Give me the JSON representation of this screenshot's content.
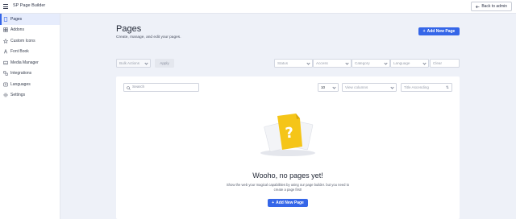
{
  "topbar": {
    "app_title": "SP Page Builder",
    "back_label": "Back to admin"
  },
  "sidebar": {
    "items": [
      {
        "label": "Pages",
        "icon": "pages-icon",
        "active": true
      },
      {
        "label": "Addons",
        "icon": "addons-icon"
      },
      {
        "label": "Custom Icons",
        "icon": "custom-icons-icon"
      },
      {
        "label": "Font Book",
        "icon": "font-book-icon"
      },
      {
        "label": "Media Manager",
        "icon": "media-manager-icon"
      },
      {
        "label": "Integrations",
        "icon": "integrations-icon"
      },
      {
        "label": "Languages",
        "icon": "languages-icon"
      },
      {
        "label": "Settings",
        "icon": "settings-icon"
      }
    ]
  },
  "header": {
    "title": "Pages",
    "subtitle": "Create, manage, and edit your pages.",
    "add_button": "Add New Page"
  },
  "filters": {
    "bulk_actions": "Bulk Actions",
    "apply": "Apply",
    "status": "Status",
    "access": "Access",
    "category": "Category",
    "language": "Language",
    "clear": "Clear"
  },
  "table_controls": {
    "search_placeholder": "Search",
    "per_page": "10",
    "view_columns": "View columns",
    "sort": "Title Ascending"
  },
  "empty_state": {
    "title": "Wooho, no pages yet!",
    "description": "Show the web your magical capabilities by using our page builder. but you need to create a page first!",
    "button": "Add New Page"
  },
  "colors": {
    "accent": "#3566e8",
    "illustration_yellow": "#f5c518"
  }
}
